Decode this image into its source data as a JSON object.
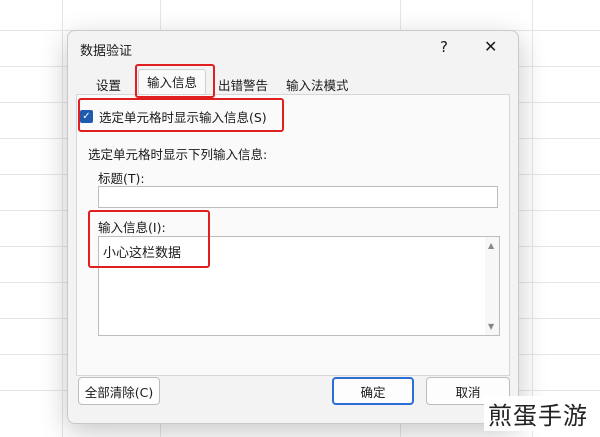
{
  "dialog": {
    "title": "数据验证",
    "help_label": "?",
    "close_label": "✕"
  },
  "tabs": [
    {
      "label": "设置"
    },
    {
      "label": "输入信息"
    },
    {
      "label": "出错警告"
    },
    {
      "label": "输入法模式"
    }
  ],
  "checkbox": {
    "label": "选定单元格时显示输入信息(S)",
    "checked": true
  },
  "section_label": "选定单元格时显示下列输入信息:",
  "title_field": {
    "label": "标题(T):",
    "value": ""
  },
  "message_field": {
    "label": "输入信息(I):",
    "value": "小心这栏数据"
  },
  "buttons": {
    "clear_all": "全部清除(C)",
    "ok": "确定",
    "cancel": "取消"
  },
  "watermark": "煎蛋手游",
  "colors": {
    "accent": "#1e5bb0",
    "highlight": "#e02020"
  }
}
